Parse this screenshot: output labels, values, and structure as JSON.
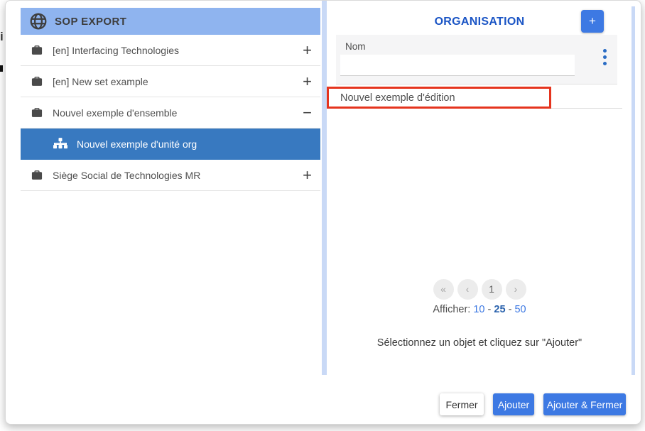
{
  "background": {
    "partial_text": "i"
  },
  "left_panel": {
    "header": {
      "title": "SOP EXPORT"
    },
    "tree": [
      {
        "label": "[en] Interfacing Technologies",
        "expander": "+"
      },
      {
        "label": "[en] New set example",
        "expander": "+"
      },
      {
        "label": "Nouvel exemple d'ensemble",
        "expander": "−"
      },
      {
        "label": "Nouvel exemple d'unité org",
        "expander": ""
      },
      {
        "label": "Siège Social de Technologies MR",
        "expander": "+"
      }
    ]
  },
  "right_panel": {
    "title": "ORGANISATION",
    "add_button_label": "+",
    "filter": {
      "label": "Nom",
      "value": ""
    },
    "result_row": {
      "label": "Nouvel exemple d'édition"
    },
    "pagination": {
      "first_label": "«",
      "prev_label": "‹",
      "current_page": "1",
      "next_label": "›",
      "show_label": "Afficher:",
      "sizes": [
        "10",
        "25",
        "50"
      ],
      "selected_size": "25",
      "separator": "-"
    },
    "hint": "Sélectionnez un objet et cliquez sur \"Ajouter\""
  },
  "footer": {
    "close_label": "Fermer",
    "add_label": "Ajouter",
    "add_close_label": "Ajouter & Fermer"
  },
  "colors": {
    "header_blue": "#8fb4ef",
    "selected_row_blue": "#3879c0",
    "button_blue": "#3d79e3",
    "title_blue": "#1b55c5",
    "scrollbar_blue": "#c9d9f6",
    "highlight_red": "#e5341e"
  }
}
